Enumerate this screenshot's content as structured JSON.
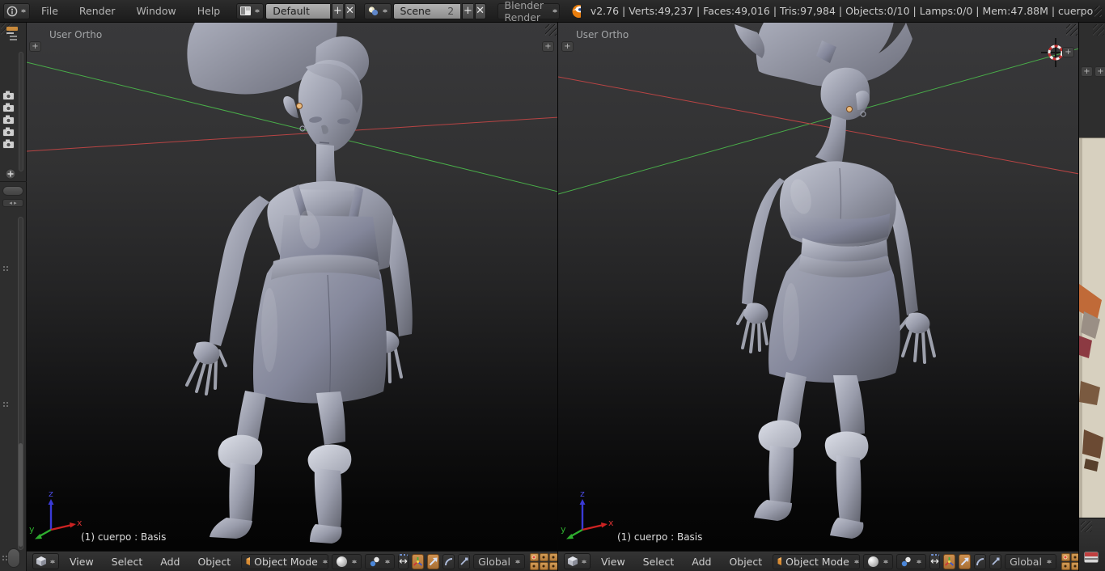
{
  "topbar": {
    "menus": {
      "file": "File",
      "render": "Render",
      "window": "Window",
      "help": "Help"
    },
    "layout_field": {
      "value": "Default"
    },
    "scene_field": {
      "value": "Scene",
      "users": "2"
    },
    "engine_select": {
      "value": "Blender Render"
    },
    "stats": "v2.76 | Verts:49,237 | Faces:49,016 | Tris:97,984 | Objects:0/10 | Lamps:0/0 | Mem:47.88M | cuerpo"
  },
  "viewport": {
    "label": "User Ortho",
    "status": "(1) cuerpo : Basis",
    "axis": {
      "x": "x",
      "y": "y",
      "z": "z"
    }
  },
  "vheader": {
    "menus": {
      "view": "View",
      "select": "Select",
      "add": "Add",
      "object": "Object"
    },
    "mode_select": "Object Mode",
    "orientation_select": "Global"
  },
  "glyphs": {
    "plus": "+",
    "close": "✕",
    "arrows": "↔"
  },
  "icons": {
    "info_editor": "circled-i",
    "window_layout": "split-window",
    "scene": "two-spheres",
    "blender_logo": "orange-swirl",
    "viewport_editor": "cube",
    "object_mode": "orange-cube",
    "viewport_shading": "white-sphere",
    "pivot_point": "two-dots",
    "manipulator_toggle": "double-arrow",
    "manip_translate": "axis-tripod",
    "manip_rotate": "arc",
    "manip_scale": "diagonal-arrow",
    "layers": "dot-grid",
    "camera": "camera",
    "image_editor": "picture",
    "updown": "stacked-triangles"
  },
  "colors": {
    "accent_orange": "#cd9050",
    "floor_line_red": "#b84444",
    "floor_line_green": "#49ad49",
    "axis_x": "#cc3333",
    "axis_y": "#2fae2f",
    "axis_z": "#3a3ad6",
    "model_gray": "#9a9daa",
    "cursor_dot": "#eabb7e",
    "paper": "#d7d0bf"
  }
}
